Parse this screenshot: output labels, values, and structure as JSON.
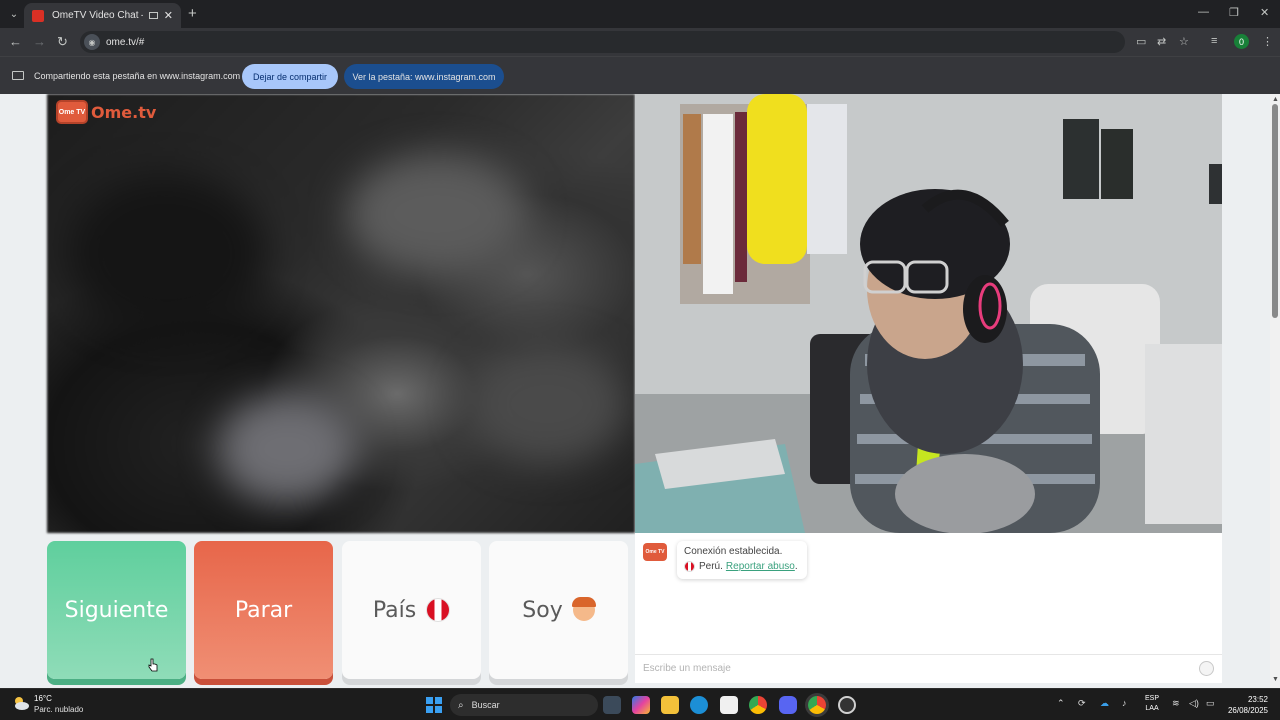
{
  "browser": {
    "tab_title": "OmeTV Video Chat — Ome",
    "url": "ome.tv/#",
    "profile_initial": "0"
  },
  "sharing_bar": {
    "message": "Compartiendo esta pestaña en www.instagram.com",
    "stop_button": "Dejar de compartir",
    "view_button": "Ver la pestaña: www.instagram.com"
  },
  "logo": {
    "text": "Ome.tv",
    "badge": "Ome TV"
  },
  "controls": {
    "next_label": "Siguiente",
    "stop_label": "Parar",
    "country_label": "País",
    "gender_label": "Soy"
  },
  "chat": {
    "status_message": "Conexión establecida.",
    "country": "Perú.",
    "report_link": "Reportar abuso",
    "report_suffix": ".",
    "input_placeholder": "Escribe un mensaje"
  },
  "taskbar": {
    "temperature": "16°C",
    "weather": "Parc. nublado",
    "search_label": "Buscar",
    "language_top": "ESP",
    "language_bottom": "LAA",
    "time": "23:52",
    "date": "26/08/2025"
  },
  "colors": {
    "next_button": "#5fcf9d",
    "stop_button": "#e7664a",
    "brand": "#e05b3c"
  }
}
